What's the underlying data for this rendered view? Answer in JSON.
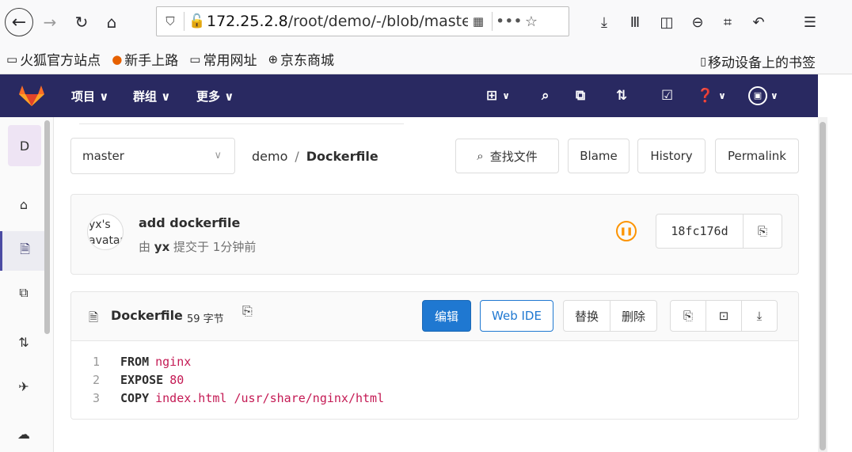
{
  "browser": {
    "url_prefix": "172.25.2.8",
    "url_path": "/root/demo/-/blob/master/",
    "bookmarks": [
      "火狐官方站点",
      "新手上路",
      "常用网址",
      "京东商城"
    ],
    "mobile_bookmarks": "移动设备上的书签"
  },
  "header": {
    "menu": [
      "项目 ∨",
      "群组 ∨",
      "更多 ∨"
    ]
  },
  "sidebar": {
    "project_letter": "D"
  },
  "repo": {
    "branch": "master",
    "project": "demo",
    "file": "Dockerfile",
    "find_file": "查找文件",
    "blame": "Blame",
    "history": "History",
    "permalink": "Permalink"
  },
  "commit": {
    "avatar_alt": "yx's avatar",
    "title": "add dockerfile",
    "by": "由",
    "author": "yx",
    "committed": "提交于 1分钟前",
    "sha": "18fc176d",
    "pipeline_status": "pending"
  },
  "file": {
    "name": "Dockerfile",
    "size": "59 字节",
    "edit": "编辑",
    "web_ide": "Web IDE",
    "replace": "替换",
    "delete": "删除",
    "lines": [
      {
        "num": "1",
        "keyword": "FROM",
        "value": "nginx"
      },
      {
        "num": "2",
        "keyword": "EXPOSE",
        "value": "80"
      },
      {
        "num": "3",
        "keyword": "COPY",
        "value": "index.html /usr/share/nginx/html"
      }
    ]
  },
  "colors": {
    "header_bg": "#292961",
    "primary": "#1f78d1",
    "pipeline_pending": "#fc9403",
    "code_value": "#c41a54"
  }
}
